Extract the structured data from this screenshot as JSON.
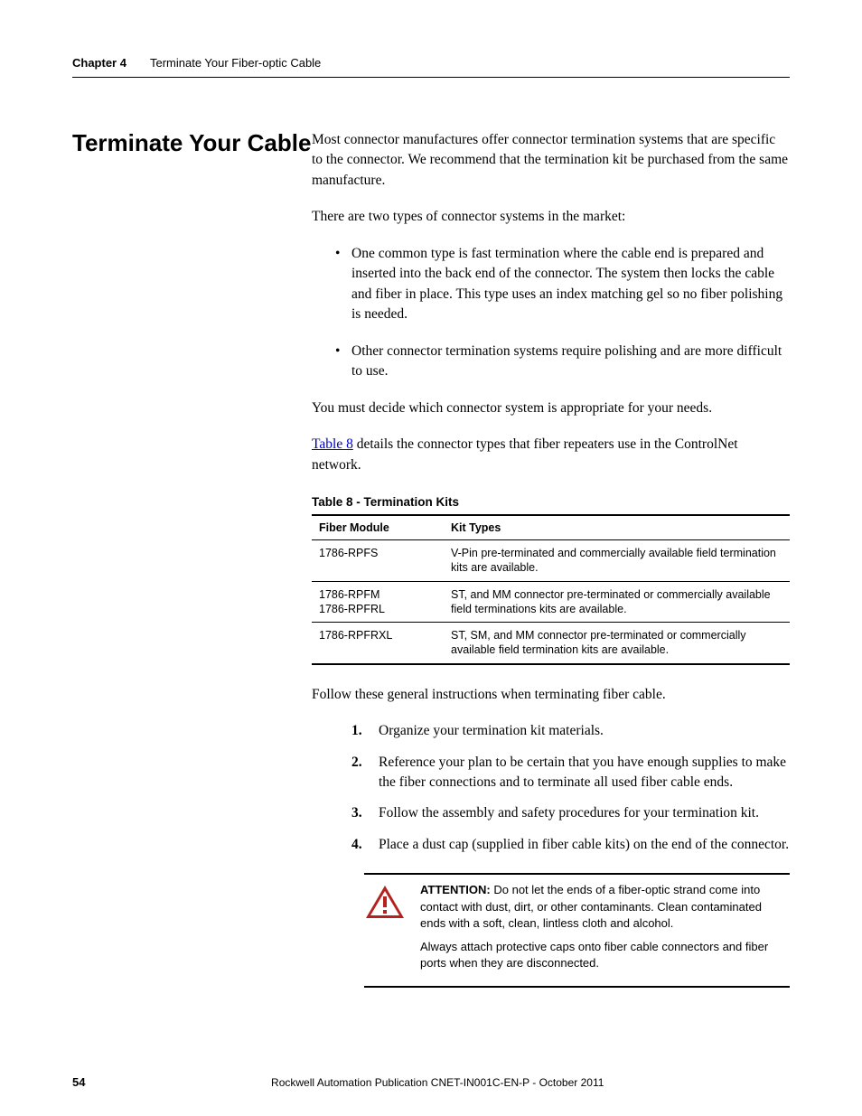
{
  "header": {
    "chapter": "Chapter 4",
    "title": "Terminate Your Fiber-optic Cable"
  },
  "section": {
    "title": "Terminate Your Cable",
    "intro1": "Most connector manufactures offer connector termination systems that are specific to the connector.  We recommend that the termination kit be purchased from the same manufacture.",
    "intro2": "There are two types of connector systems in the market:",
    "bullets": [
      "One common type is fast termination where the cable end is prepared and inserted into the back end of the connector. The system then locks the cable and fiber in place. This type uses an index matching gel so no fiber polishing is needed.",
      "Other connector termination systems require polishing and are more difficult to use."
    ],
    "after_bullets": "You must decide which connector system is appropriate for your needs.",
    "table_ref_link": "Table 8",
    "table_ref_rest": " details the connector types that fiber repeaters use in the ControlNet network."
  },
  "table": {
    "caption": "Table 8 - Termination Kits",
    "headers": [
      "Fiber Module",
      "Kit Types"
    ],
    "rows": [
      {
        "module": "1786-RPFS",
        "kit": "V-Pin pre-terminated and commercially available field termination kits are available."
      },
      {
        "module": "1786-RPFM\n1786-RPFRL",
        "kit": "ST, and MM connector pre-terminated or commercially available field terminations kits are available."
      },
      {
        "module": "1786-RPFRXL",
        "kit": "ST, SM, and MM connector pre-terminated or commercially available field termination kits are available."
      }
    ]
  },
  "instructions": {
    "lead": "Follow these general instructions when terminating fiber cable.",
    "steps": [
      "Organize your termination kit materials.",
      "Reference your plan to be certain that you have enough supplies to make the fiber connections and to terminate all used fiber cable ends.",
      "Follow the assembly and safety procedures for your termination kit.",
      "Place a dust cap (supplied in fiber cable kits) on the end of the connector."
    ]
  },
  "attention": {
    "label": "ATTENTION:",
    "p1": " Do not let the ends of a fiber-optic strand come into contact with dust, dirt, or other contaminants. Clean contaminated ends with a soft, clean, lintless cloth and alcohol.",
    "p2": "Always attach protective caps onto fiber cable connectors and fiber ports when they are disconnected."
  },
  "footer": {
    "page": "54",
    "pub": "Rockwell Automation Publication CNET-IN001C-EN-P - October 2011"
  }
}
